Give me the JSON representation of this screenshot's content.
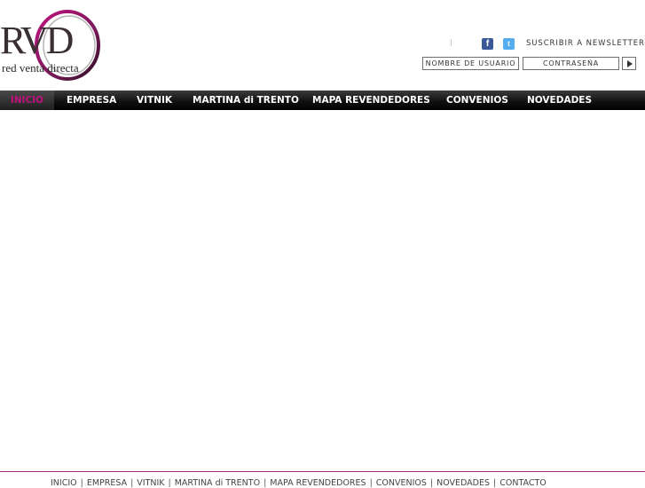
{
  "brand": {
    "letters": "RVD",
    "tagline": "red venta directa",
    "accent_color": "#c0127f",
    "ring_color": "#7a1a5a"
  },
  "header": {
    "social": [
      {
        "icon": "facebook-icon",
        "glyph": "f"
      },
      {
        "icon": "twitter-icon",
        "glyph": "t"
      }
    ],
    "newsletter_label": "SUSCRIBIR A NEWSLETTER",
    "login": {
      "username_placeholder": "NOMBRE DE USUARIO",
      "password_placeholder": "CONTRASEÑA",
      "submit_icon": "play-arrow-icon"
    }
  },
  "nav": {
    "active_index": 0,
    "items": [
      "INICIO",
      "EMPRESA",
      "VITNIK",
      "MARTINA di TRENTO",
      "MAPA REVENDEDORES",
      "CONVENIOS",
      "NOVEDADES"
    ]
  },
  "footer": {
    "links": [
      "INICIO",
      "EMPRESA",
      "VITNIK",
      "MARTINA di TRENTO",
      "MAPA REVENDEDORES",
      "CONVENIOS",
      "NOVEDADES",
      "CONTACTO"
    ],
    "separator": "|"
  }
}
